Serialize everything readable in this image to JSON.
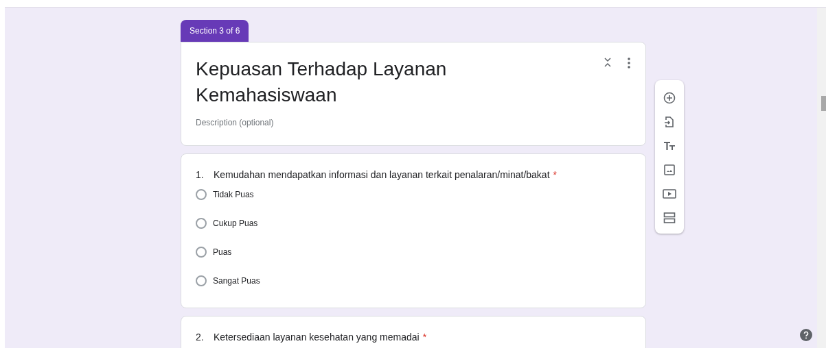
{
  "section_tab": {
    "label": "Section 3 of 6"
  },
  "section": {
    "title": "Kepuasan Terhadap Layanan Kemahasiswaan",
    "description_placeholder": "Description (optional)"
  },
  "questions": [
    {
      "number": "1.",
      "text": "Kemudahan mendapatkan informasi dan layanan terkait penalaran/minat/bakat",
      "required_mark": "*",
      "options": [
        {
          "label": "Tidak Puas",
          "selected": false
        },
        {
          "label": "Cukup Puas",
          "selected": false
        },
        {
          "label": "Puas",
          "selected": false
        },
        {
          "label": "Sangat Puas",
          "selected": false
        }
      ]
    },
    {
      "number": "2.",
      "text": "Ketersediaan layanan kesehatan yang memadai",
      "required_mark": "*"
    }
  ],
  "toolbar": [
    {
      "kind": "add"
    },
    {
      "kind": "import"
    },
    {
      "kind": "title"
    },
    {
      "kind": "image"
    },
    {
      "kind": "video"
    },
    {
      "kind": "section"
    }
  ]
}
